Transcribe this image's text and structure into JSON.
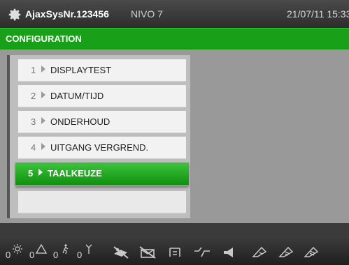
{
  "header": {
    "system_name": "AjaxSysNr.123456",
    "level": "NIVO 7",
    "datetime": "21/07/11 15:33",
    "icon": "gear-icon"
  },
  "title": "CONFIGURATION",
  "menu": {
    "items": [
      {
        "num": "1",
        "label": "DISPLAYTEST"
      },
      {
        "num": "2",
        "label": "DATUM/TIJD"
      },
      {
        "num": "3",
        "label": "ONDERHOUD"
      },
      {
        "num": "4",
        "label": "UITGANG VERGREND."
      },
      {
        "num": "5",
        "label": "TAALKEUZE",
        "selected": true
      }
    ]
  },
  "status": {
    "counters": [
      {
        "value": "0",
        "icon": "sun-icon"
      },
      {
        "value": "0",
        "icon": "warning-triangle-icon"
      },
      {
        "value": "0",
        "icon": "person-walking-icon"
      },
      {
        "value": "0",
        "icon": "antenna-icon"
      }
    ],
    "icons": [
      "no-intruder-icon",
      "no-mail-icon",
      "tamper-icon",
      "bypass-icon",
      "speaker-icon",
      "partition-1-icon",
      "partition-2-icon",
      "partition-3-icon"
    ]
  },
  "colors": {
    "accent": "#18a018",
    "selected": "#22b022",
    "header": "#333333",
    "background": "#999999"
  }
}
